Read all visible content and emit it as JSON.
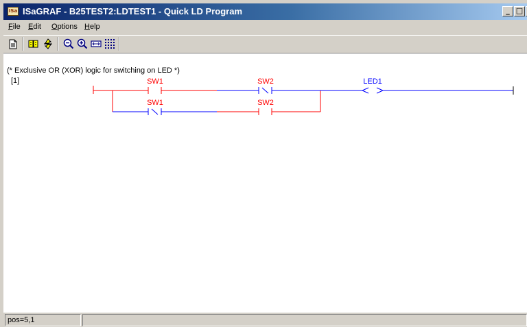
{
  "window": {
    "app_icon_label": "ISa",
    "title": "ISaGRAF - B25TEST2:LDTEST1 - Quick LD Program",
    "minimize_glyph": "_",
    "maximize_glyph": "□",
    "close_glyph": "×"
  },
  "menu": {
    "items": [
      {
        "accel": "F",
        "rest": "ile"
      },
      {
        "accel": "E",
        "rest": "dit"
      },
      {
        "accel": "O",
        "rest": "ptions"
      },
      {
        "accel": "H",
        "rest": "elp"
      }
    ]
  },
  "toolbar": {
    "icons": [
      "document-icon",
      "blocks-icon",
      "arrows-icon",
      "zoom-out-icon",
      "zoom-in-icon",
      "fit-icon",
      "grid-icon"
    ]
  },
  "program": {
    "comment": "(* Exclusive OR (XOR) logic for switching on LED *)",
    "rung_number": "[1]",
    "contacts": [
      {
        "label": "SW1",
        "type": "normally-open",
        "row": 1,
        "color": "#ff0000"
      },
      {
        "label": "SW2",
        "type": "normally-closed",
        "row": 1,
        "color": "#0000ff"
      },
      {
        "label": "SW1",
        "type": "normally-closed",
        "row": 2,
        "color": "#0000ff"
      },
      {
        "label": "SW2",
        "type": "normally-open",
        "row": 2,
        "color": "#ff0000"
      }
    ],
    "coil": {
      "label": "LED1",
      "color": "#0000ff"
    }
  },
  "status": {
    "position": "pos=5,1",
    "message": ""
  }
}
